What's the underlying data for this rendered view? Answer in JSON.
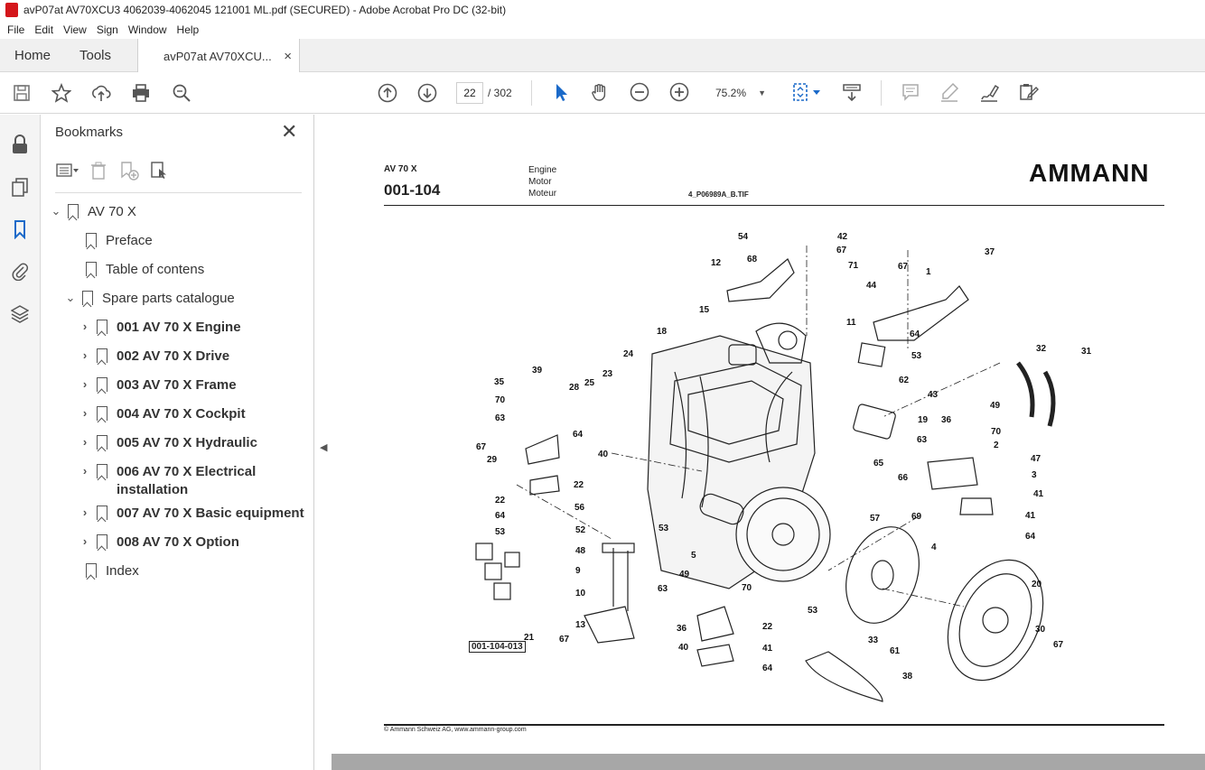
{
  "window": {
    "title": "avP07at AV70XCU3 4062039-4062045 121001 ML.pdf (SECURED) - Adobe Acrobat Pro DC (32-bit)"
  },
  "menu": [
    "File",
    "Edit",
    "View",
    "Sign",
    "Window",
    "Help"
  ],
  "tabs": {
    "home": "Home",
    "tools": "Tools",
    "document": "avP07at AV70XCU...",
    "close_glyph": "×"
  },
  "toolbar": {
    "page_current": "22",
    "page_total": "/ 302",
    "zoom": "75.2%"
  },
  "bookmarks": {
    "title": "Bookmarks",
    "items": [
      {
        "label": "AV 70 X",
        "expand": "open"
      },
      {
        "label": "Preface"
      },
      {
        "label": "Table of contens"
      },
      {
        "label": "Spare parts catalogue",
        "expand": "open"
      },
      {
        "label": "001 AV 70 X Engine",
        "expand": "closed"
      },
      {
        "label": "002 AV 70 X Drive",
        "expand": "closed"
      },
      {
        "label": "003 AV 70 X Frame",
        "expand": "closed"
      },
      {
        "label": "004 AV 70 X Cockpit",
        "expand": "closed"
      },
      {
        "label": "005 AV 70 X Hydraulic",
        "expand": "closed"
      },
      {
        "label": "006 AV 70 X Electrical installation",
        "expand": "closed"
      },
      {
        "label": "007 AV 70 X Basic equipment",
        "expand": "closed"
      },
      {
        "label": "008 AV 70 X Option",
        "expand": "closed"
      },
      {
        "label": "Index"
      }
    ]
  },
  "document": {
    "model": "AV 70 X",
    "page_code": "001-104",
    "category": [
      "Engine",
      "Motor",
      "Moteur"
    ],
    "file_ref": "4_P06989A_B.TIF",
    "logo": "AMMANN",
    "footer": "© Ammann Schweiz AG, www.ammann-group.com",
    "callout_box": "001-104-013",
    "callouts": [
      "54",
      "42",
      "67",
      "12",
      "68",
      "71",
      "44",
      "37",
      "1",
      "67",
      "15",
      "18",
      "11",
      "64",
      "53",
      "32",
      "31",
      "24",
      "23",
      "25",
      "35",
      "39",
      "28",
      "70",
      "63",
      "64",
      "62",
      "43",
      "49",
      "19",
      "36",
      "70",
      "63",
      "2",
      "67",
      "29",
      "40",
      "22",
      "56",
      "52",
      "65",
      "66",
      "57",
      "69",
      "47",
      "3",
      "41",
      "22",
      "64",
      "53",
      "41",
      "64",
      "53",
      "48",
      "9",
      "10",
      "5",
      "49",
      "70",
      "63",
      "36",
      "4",
      "20",
      "21",
      "13",
      "67",
      "40",
      "22",
      "41",
      "64",
      "53",
      "33",
      "61",
      "38",
      "30",
      "67",
      "40"
    ]
  }
}
